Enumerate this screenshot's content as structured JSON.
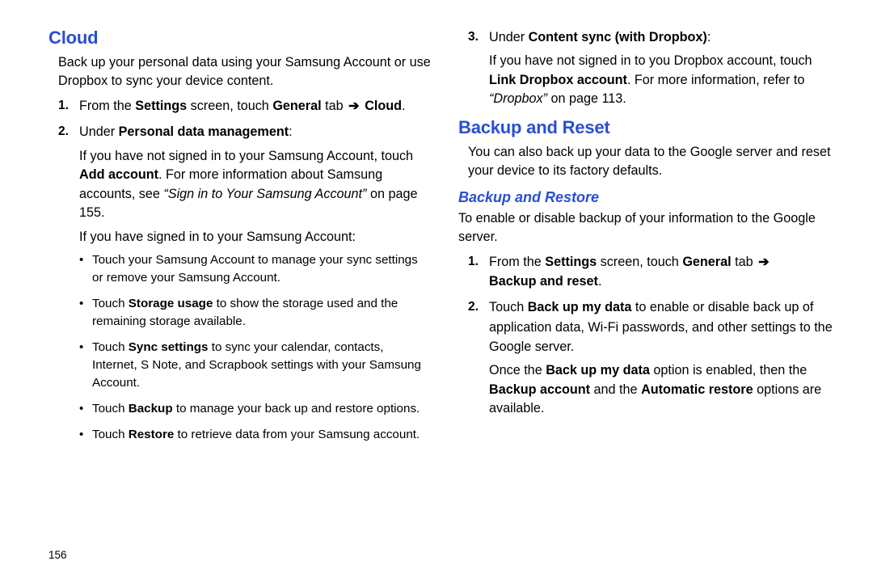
{
  "page_number": "156",
  "left": {
    "cloud_h": "Cloud",
    "cloud_intro": "Back up your personal data using your Samsung Account or use Dropbox to sync your device content.",
    "s1_a": "From the ",
    "s1_b": "Settings",
    "s1_c": " screen, touch ",
    "s1_d": "General",
    "s1_e": " tab ",
    "s1_f": "Cloud",
    "s1_g": ".",
    "s2_a": "Under ",
    "s2_b": "Personal data management",
    "s2_c": ":",
    "s2_p1_a": "If you have not signed in to your Samsung Account, touch ",
    "s2_p1_b": "Add account",
    "s2_p1_c": ". For more information about Samsung accounts, see ",
    "s2_p1_d": "“Sign in to Your Samsung Account”",
    "s2_p1_e": " on page 155.",
    "s2_p2": "If you have signed in to your Samsung Account:",
    "b1": "Touch your Samsung Account to manage your sync settings or remove your Samsung Account.",
    "b2_a": "Touch ",
    "b2_b": "Storage usage",
    "b2_c": " to show the storage used and the remaining storage available.",
    "b3_a": "Touch ",
    "b3_b": "Sync settings",
    "b3_c": " to sync your calendar, contacts, Internet, S Note, and Scrapbook settings with your Samsung Account.",
    "b4_a": "Touch ",
    "b4_b": "Backup",
    "b4_c": " to manage your back up and restore options.",
    "b5_a": "Touch ",
    "b5_b": "Restore",
    "b5_c": " to retrieve data from your Samsung account."
  },
  "right": {
    "s3_a": "Under ",
    "s3_b": "Content sync (with Dropbox)",
    "s3_c": ":",
    "s3_p_a": "If you have not signed in to you Dropbox account, touch ",
    "s3_p_b": "Link Dropbox account",
    "s3_p_c": ". For more information, refer to ",
    "s3_p_d": "“Dropbox”",
    "s3_p_e": " on page 113.",
    "br_h": "Backup and Reset",
    "br_intro": "You can also back up your data to the Google server and reset your device to its factory defaults.",
    "brr_h": "Backup and Restore",
    "brr_intro": "To enable or disable backup of your information to the Google server.",
    "r1_a": "From the ",
    "r1_b": "Settings",
    "r1_c": " screen, touch ",
    "r1_d": "General",
    "r1_e": " tab ",
    "r1_f": "Backup and reset",
    "r1_g": ".",
    "r2_a": "Touch ",
    "r2_b": "Back up my data",
    "r2_c": " to enable or disable back up of application data, Wi-Fi passwords, and other settings to the Google server.",
    "r2_p2_a": "Once the ",
    "r2_p2_b": "Back up my data",
    "r2_p2_c": " option is enabled, then the ",
    "r2_p2_d": "Backup account",
    "r2_p2_e": " and the ",
    "r2_p2_f": "Automatic restore",
    "r2_p2_g": " options are available."
  }
}
